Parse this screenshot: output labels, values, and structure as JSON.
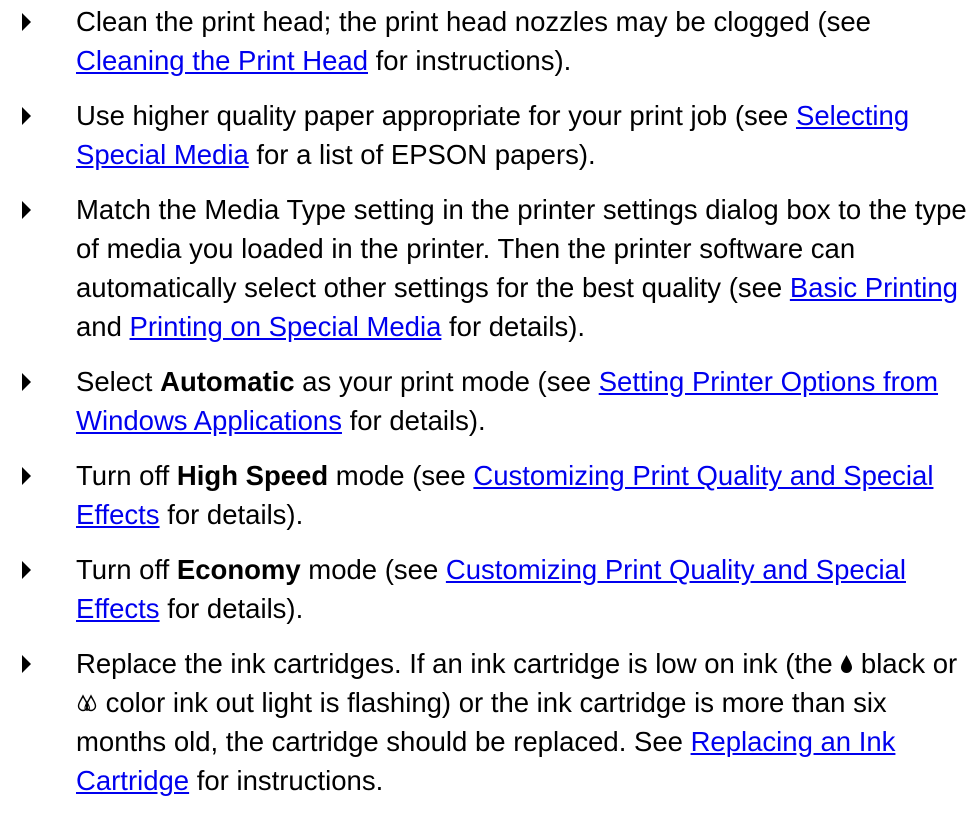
{
  "items": [
    {
      "t1": "Clean the print head; the print head nozzles may be clogged (see ",
      "link1": "Cleaning the Print Head",
      "t2": " for instructions)."
    },
    {
      "t1": "Use higher quality paper appropriate for your print job (see ",
      "link1": "Selecting Special Media",
      "t2": " for a list of EPSON papers)."
    },
    {
      "t1": "Match the Media Type setting in the printer settings dialog box to the type of media you loaded in the printer. Then the printer software can automatically select other settings for the best quality (see ",
      "link1": "Basic Printing",
      "t2": " and ",
      "link2": "Printing on Special Media",
      "t3": " for details)."
    },
    {
      "t1": "Select ",
      "bold": "Automatic",
      "t2": " as your print mode (see ",
      "link1": "Setting Printer Options from Windows Applications",
      "t3": " for details)."
    },
    {
      "t1": "Turn off ",
      "bold": "High Speed",
      "t2": " mode (see ",
      "link1": "Customizing Print Quality and Special Effects",
      "t3": " for details)."
    },
    {
      "t1": "Turn off ",
      "bold": "Economy",
      "t2": " mode (see ",
      "link1": "Customizing Print Quality and Special Effects",
      "t3": " for details)."
    },
    {
      "t1": "Replace the ink cartridges. If an ink cartridge is low on ink (the ",
      "black_icon": "black-ink-drop-icon",
      "t2": " black or ",
      "color_icon": "color-ink-drops-icon",
      "t3": " color ink out light is flashing) or the ink cartridge is more than six months old, the cartridge should be replaced. See ",
      "link1": "Replacing an Ink Cartridge",
      "t4": " for instructions."
    }
  ],
  "styles": {
    "link_color": "#0000ee",
    "text_color": "#000000",
    "bullet_icon": "triangle-bullet-icon"
  }
}
